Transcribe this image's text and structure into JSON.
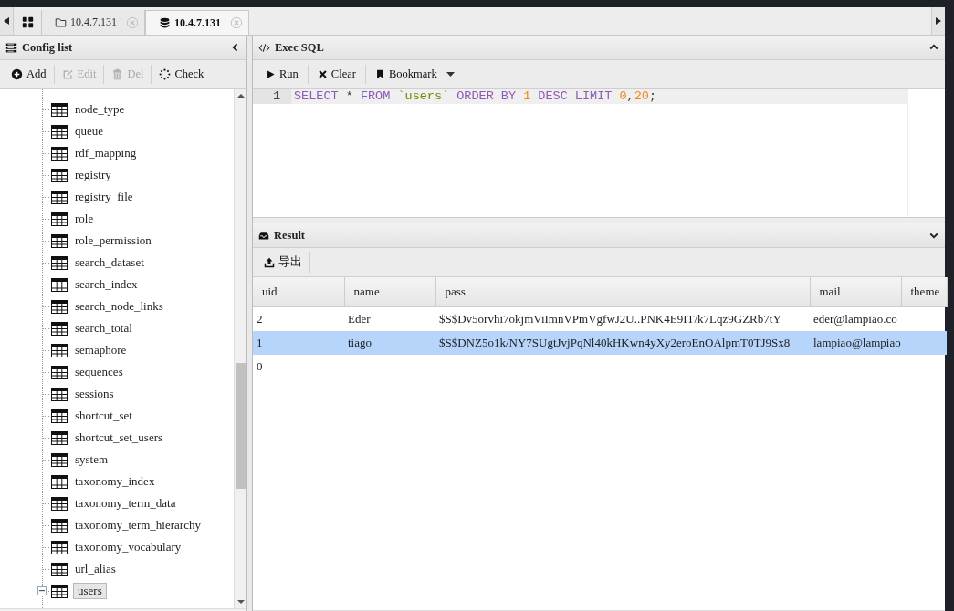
{
  "tabs": [
    {
      "kind": "home",
      "selected": false
    },
    {
      "kind": "folder",
      "label": "10.4.7.131",
      "selected": false
    },
    {
      "kind": "database",
      "label": "10.4.7.131",
      "selected": true
    }
  ],
  "config_panel": {
    "title": "Config list",
    "toolbar": [
      {
        "kind": "add",
        "label": "Add",
        "disabled": false
      },
      {
        "kind": "edit",
        "label": "Edit",
        "disabled": true
      },
      {
        "kind": "delete",
        "label": "Del",
        "disabled": true
      },
      {
        "kind": "check",
        "label": "Check",
        "disabled": false
      }
    ],
    "tables": [
      {
        "name": "node_type",
        "expanded": false,
        "selected": false
      },
      {
        "name": "queue",
        "expanded": false,
        "selected": false
      },
      {
        "name": "rdf_mapping",
        "expanded": false,
        "selected": false
      },
      {
        "name": "registry",
        "expanded": false,
        "selected": false
      },
      {
        "name": "registry_file",
        "expanded": false,
        "selected": false
      },
      {
        "name": "role",
        "expanded": false,
        "selected": false
      },
      {
        "name": "role_permission",
        "expanded": false,
        "selected": false
      },
      {
        "name": "search_dataset",
        "expanded": false,
        "selected": false
      },
      {
        "name": "search_index",
        "expanded": false,
        "selected": false
      },
      {
        "name": "search_node_links",
        "expanded": false,
        "selected": false
      },
      {
        "name": "search_total",
        "expanded": false,
        "selected": false
      },
      {
        "name": "semaphore",
        "expanded": false,
        "selected": false
      },
      {
        "name": "sequences",
        "expanded": false,
        "selected": false
      },
      {
        "name": "sessions",
        "expanded": false,
        "selected": false
      },
      {
        "name": "shortcut_set",
        "expanded": false,
        "selected": false
      },
      {
        "name": "shortcut_set_users",
        "expanded": false,
        "selected": false
      },
      {
        "name": "system",
        "expanded": false,
        "selected": false
      },
      {
        "name": "taxonomy_index",
        "expanded": false,
        "selected": false
      },
      {
        "name": "taxonomy_term_data",
        "expanded": false,
        "selected": false
      },
      {
        "name": "taxonomy_term_hierarchy",
        "expanded": false,
        "selected": false
      },
      {
        "name": "taxonomy_vocabulary",
        "expanded": false,
        "selected": false
      },
      {
        "name": "url_alias",
        "expanded": false,
        "selected": false
      },
      {
        "name": "users",
        "expanded": true,
        "selected": true
      }
    ]
  },
  "sql_panel": {
    "title": "Exec SQL",
    "toolbar": [
      {
        "kind": "run",
        "label": "Run"
      },
      {
        "kind": "clear",
        "label": "Clear"
      },
      {
        "kind": "bookmark",
        "label": "Bookmark"
      }
    ],
    "line_number": "1",
    "tokens": [
      {
        "kind": "keyword",
        "text": "SELECT"
      },
      {
        "kind": "plain",
        "text": " * "
      },
      {
        "kind": "keyword",
        "text": "FROM"
      },
      {
        "kind": "string",
        "text": " `users`"
      },
      {
        "kind": "keyword",
        "text": " ORDER BY"
      },
      {
        "kind": "number",
        "text": " 1"
      },
      {
        "kind": "keyword",
        "text": " DESC LIMIT"
      },
      {
        "kind": "number",
        "text": " 0"
      },
      {
        "kind": "plain",
        "text": ","
      },
      {
        "kind": "number",
        "text": "20"
      },
      {
        "kind": "plain",
        "text": ";"
      }
    ]
  },
  "result_panel": {
    "title": "Result",
    "toolbar": [
      {
        "kind": "export",
        "label": "导出"
      }
    ],
    "columns": [
      "uid",
      "name",
      "pass",
      "mail",
      "theme"
    ],
    "rows": [
      {
        "cells": [
          "2",
          "Eder",
          "$S$Dv5orvhi7okjmViImnVPmVgfwJ2U..PNK4E9IT/k7Lqz9GZRb7tY",
          "eder@lampiao.co"
        ],
        "selected": false
      },
      {
        "cells": [
          "1",
          "tiago",
          "$S$DNZ5o1k/NY7SUgtJvjPqNl40kHKwn4yXy2eroEnOAlpmT0TJ9Sx8",
          "lampiao@lampiao"
        ],
        "selected": true
      },
      {
        "cells": [
          "0"
        ],
        "selected": false
      }
    ]
  }
}
